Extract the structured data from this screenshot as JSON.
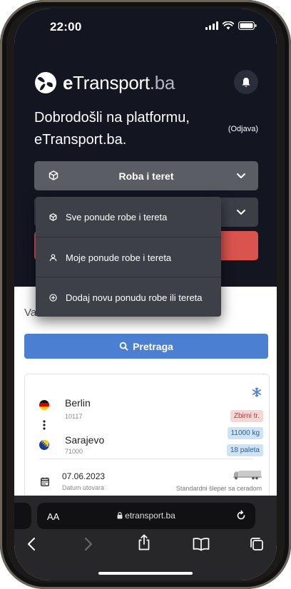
{
  "status_bar": {
    "time": "22:00"
  },
  "header": {
    "logo_bold": "e",
    "logo_main": "Transport",
    "logo_tld": ".ba",
    "welcome_text": "Dobrodošli na platformu, eTransport.ba.",
    "logout_label": "(Odjava)"
  },
  "category_select": {
    "selected": "Roba i teret"
  },
  "dropdown": {
    "items": [
      {
        "label": "Sve ponude robe i tereta",
        "icon": "box-icon"
      },
      {
        "label": "Moje ponude robe i tereta",
        "icon": "user-icon"
      },
      {
        "label": "Dodaj novu ponudu robe ili tereta",
        "icon": "plus-circle-icon"
      }
    ]
  },
  "content": {
    "partial_label": "Va",
    "search_label": "Pretraga"
  },
  "card": {
    "origin": {
      "city": "Berlin",
      "zip": "10117"
    },
    "destination": {
      "city": "Sarajevo",
      "zip": "71000"
    },
    "badges": [
      "Zbirni tr.",
      "11000 kg",
      "18 paleta"
    ],
    "date": "07.06.2023",
    "date_label": "Datum utovara",
    "truck_type": "Standardni šleper sa ceradom"
  },
  "browser": {
    "aa_label": "AA",
    "url": "etransport.ba"
  },
  "colors": {
    "hero_bg": "#131521",
    "accent_blue": "#4a7fd1",
    "accent_red": "#d9534f"
  }
}
